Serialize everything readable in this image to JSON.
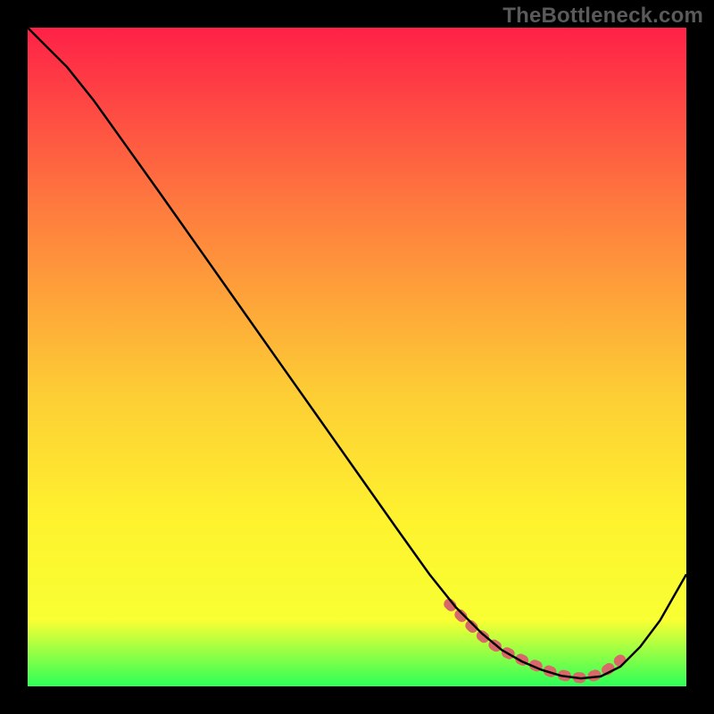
{
  "watermark": "TheBottleneck.com",
  "colors": {
    "page_bg": "#000000",
    "gradient_top": "#fe2147",
    "gradient_mid1": "#fe7d3e",
    "gradient_mid2": "#fdcc35",
    "gradient_mid3": "#fef32e",
    "gradient_mid4": "#f8ff33",
    "gradient_bottom": "#2dff58",
    "curve": "#000000",
    "marker": "#d96868"
  },
  "chart_data": {
    "type": "line",
    "title": "",
    "xlabel": "",
    "ylabel": "",
    "xlim": [
      0,
      100
    ],
    "ylim": [
      0,
      100
    ],
    "series": [
      {
        "name": "bottleneck-curve",
        "x": [
          0,
          3,
          6,
          10,
          15,
          20,
          26,
          32,
          38,
          44,
          50,
          56,
          61,
          65,
          69,
          72,
          75,
          78,
          81,
          84,
          87,
          90,
          93,
          96,
          100
        ],
        "y": [
          100,
          97,
          94,
          89,
          82,
          75,
          66.5,
          58,
          49.5,
          41,
          32.5,
          24,
          17,
          12,
          8,
          5.5,
          3.8,
          2.5,
          1.6,
          1.2,
          1.5,
          3,
          6,
          10,
          17
        ]
      }
    ],
    "markers": {
      "name": "low-bottleneck-zone",
      "x": [
        64,
        66,
        68,
        70,
        72,
        74,
        76,
        78,
        80,
        82,
        84,
        86,
        88,
        90
      ],
      "y": [
        12.5,
        10.5,
        8.5,
        6.8,
        5.5,
        4.5,
        3.6,
        2.8,
        2.0,
        1.5,
        1.3,
        1.6,
        2.5,
        4.0
      ]
    },
    "legend": false,
    "grid": false
  }
}
